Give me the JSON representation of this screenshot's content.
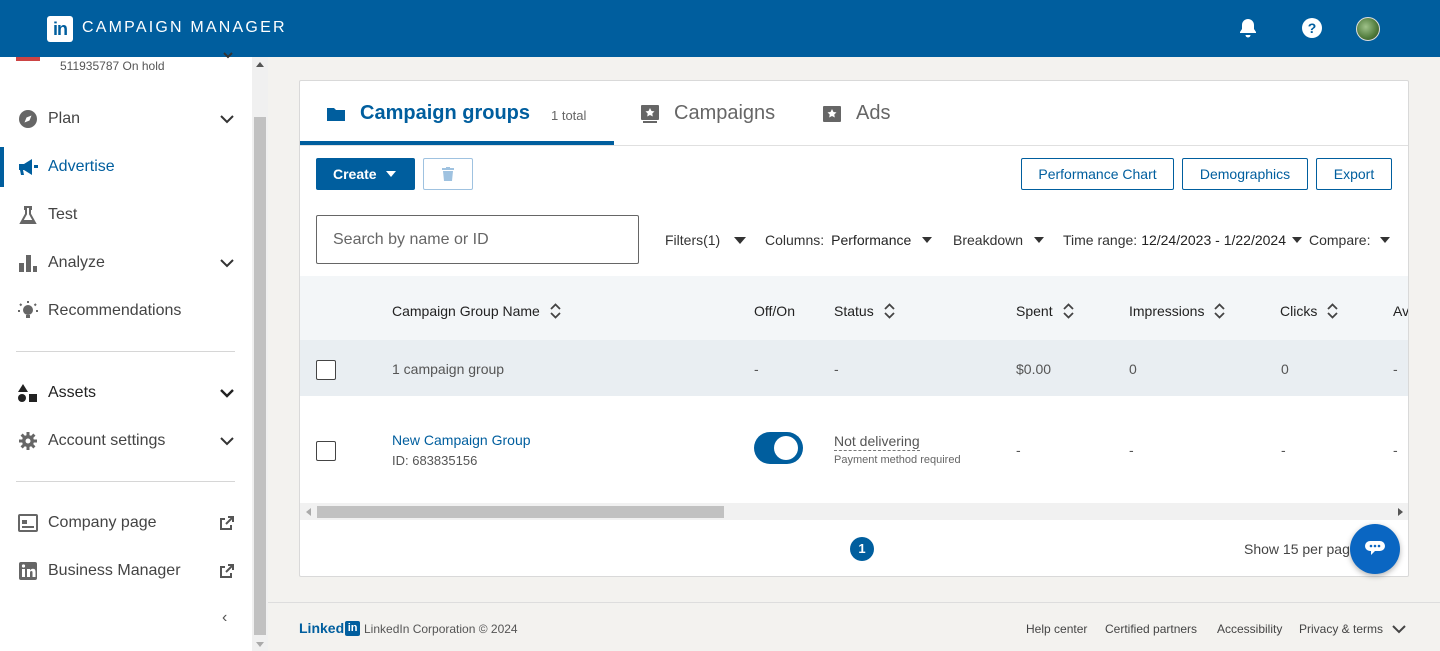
{
  "app": {
    "logo_text": "in",
    "title": "CAMPAIGN MANAGER"
  },
  "account": {
    "subtitle": "511935787 On hold"
  },
  "sidebar": {
    "items": [
      {
        "label": "Plan",
        "icon": "compass-icon",
        "has_chevron": true
      },
      {
        "label": "Advertise",
        "icon": "megaphone-icon",
        "active": true
      },
      {
        "label": "Test",
        "icon": "flask-icon"
      },
      {
        "label": "Analyze",
        "icon": "bar-chart-icon",
        "has_chevron": true
      },
      {
        "label": "Recommendations",
        "icon": "lightbulb-icon"
      },
      {
        "label": "Assets",
        "icon": "shapes-icon",
        "has_chevron": true
      },
      {
        "label": "Account settings",
        "icon": "gear-icon",
        "has_chevron": true
      },
      {
        "label": "Company page",
        "icon": "company-page-icon",
        "external": true
      },
      {
        "label": "Business Manager",
        "icon": "linkedin-icon",
        "external": true
      }
    ],
    "collapse_glyph": "‹"
  },
  "tabs": [
    {
      "label": "Campaign groups",
      "count": "1 total",
      "active": true
    },
    {
      "label": "Campaigns"
    },
    {
      "label": "Ads"
    }
  ],
  "toolbar": {
    "create_label": "Create",
    "performance_chart_label": "Performance Chart",
    "demographics_label": "Demographics",
    "export_label": "Export"
  },
  "filters": {
    "search_placeholder": "Search by name or ID",
    "filters_label": "Filters(1)",
    "columns_label": "Columns:",
    "columns_value": "Performance",
    "breakdown_label": "Breakdown",
    "time_range_label": "Time range:",
    "time_range_value": "12/24/2023 - 1/22/2024",
    "compare_label": "Compare:"
  },
  "table": {
    "columns": [
      "Campaign Group Name",
      "Off/On",
      "Status",
      "Spent",
      "Impressions",
      "Clicks",
      "Av"
    ],
    "summary": {
      "name": "1 campaign group",
      "offon": "-",
      "status": "-",
      "spent": "$0.00",
      "impressions": "0",
      "clicks": "0",
      "avg": "-"
    },
    "rows": [
      {
        "name": "New Campaign Group",
        "id": "ID: 683835156",
        "toggle_on": true,
        "status": "Not delivering",
        "status_detail": "Payment method required",
        "spent": "-",
        "impressions": "-",
        "clicks": "-",
        "avg": "-"
      }
    ]
  },
  "pagination": {
    "current_page": "1",
    "per_page_label": "Show 15 per page"
  },
  "footer": {
    "logo_text": "Linked",
    "logo_box": "in",
    "copyright": "LinkedIn Corporation © 2024",
    "links": [
      "Help center",
      "Certified partners",
      "Accessibility",
      "Privacy & terms"
    ]
  },
  "colors": {
    "brand": "#005e9e",
    "accent": "#0a66c2"
  }
}
